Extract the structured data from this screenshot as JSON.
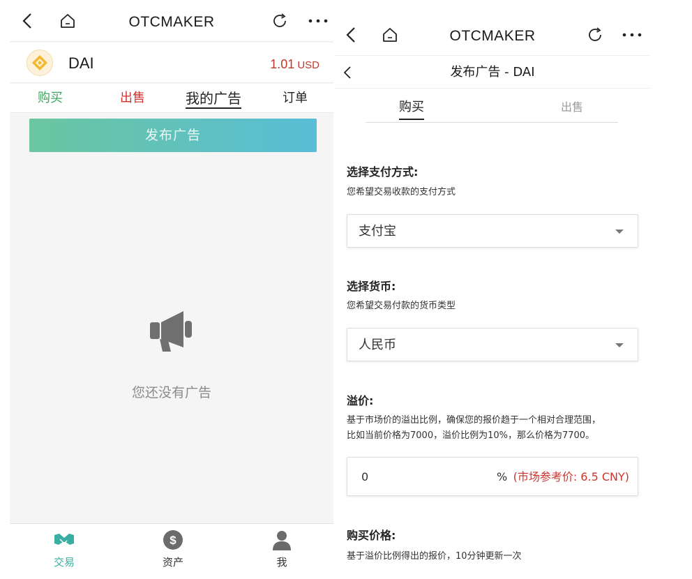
{
  "left": {
    "nav": {
      "title": "OTCMAKER",
      "back_icon": "chevron-left-icon",
      "home_icon": "home-icon",
      "refresh_icon": "refresh-icon",
      "more_icon": "more-icon"
    },
    "asset": {
      "name": "DAI",
      "price": "1.01",
      "unit": "USD",
      "logo_icon": "dai-logo-icon"
    },
    "tabs": [
      {
        "label": "购买"
      },
      {
        "label": "出售"
      },
      {
        "label": "我的广告"
      },
      {
        "label": "订单"
      }
    ],
    "publish_label": "发布广告",
    "empty": {
      "icon": "megaphone-icon",
      "text": "您还没有广告"
    },
    "bottom_nav": [
      {
        "label": "交易",
        "icon": "handshake-icon"
      },
      {
        "label": "资产",
        "icon": "dollar-icon"
      },
      {
        "label": "我",
        "icon": "user-icon"
      }
    ]
  },
  "right": {
    "nav": {
      "title": "OTCMAKER"
    },
    "subheader": {
      "title": "发布广告 - DAI"
    },
    "tabs": [
      {
        "label": "购买"
      },
      {
        "label": "出售"
      }
    ],
    "payment": {
      "title": "选择支付方式:",
      "desc": "您希望交易收款的支付方式",
      "value": "支付宝"
    },
    "currency": {
      "title": "选择货币:",
      "desc": "您希望交易付款的货币类型",
      "value": "人民币"
    },
    "premium": {
      "title": "溢价:",
      "desc_line1": "基于市场价的溢出比例，确保您的报价趋于一个相对合理范围，",
      "desc_line2": "比如当前价格为7000，溢价比例为10%，那么价格为7700。",
      "value": "0",
      "unit": "%",
      "reference": "(市场参考价: 6.5  CNY)"
    },
    "buy_price": {
      "title": "购买价格:",
      "desc": "基于溢价比例得出的报价，10分钟更新一次"
    }
  },
  "colors": {
    "buy_green": "#3fa45f",
    "sell_red": "#d0332c",
    "accent_teal": "#58bdd6",
    "price_red": "#c0392b"
  }
}
